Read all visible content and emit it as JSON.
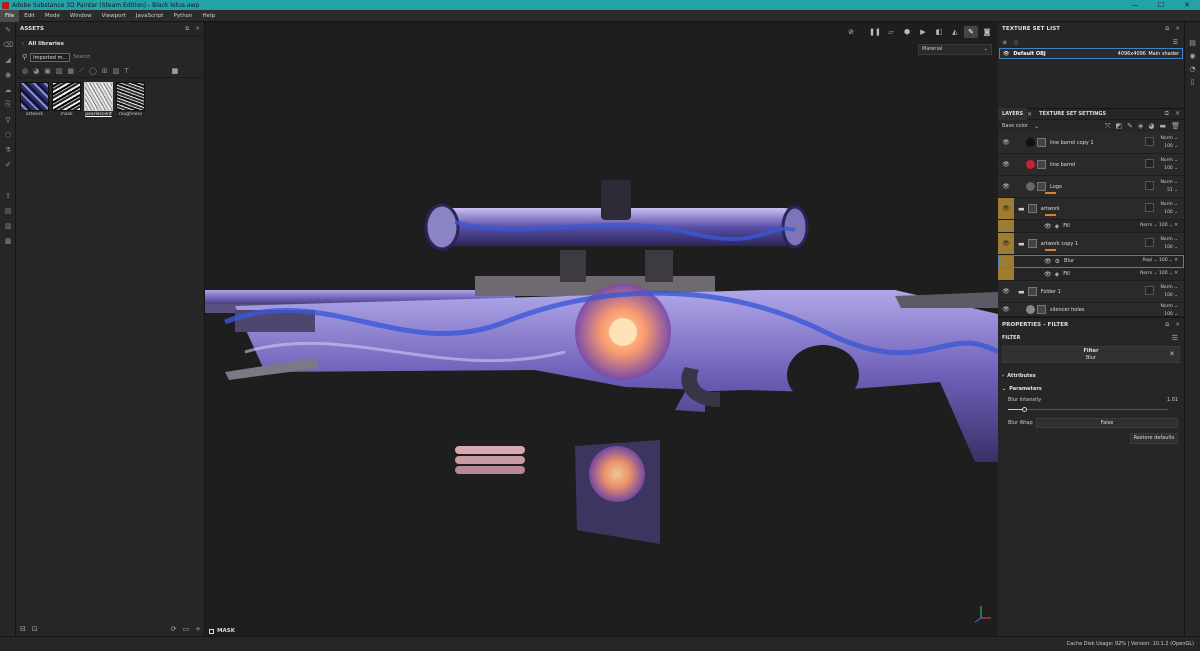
{
  "window": {
    "title": "Adobe Substance 3D Painter (Steam Edition) - Black lotus.awp"
  },
  "menu": [
    "File",
    "Edit",
    "Mode",
    "Window",
    "Viewport",
    "JavaScript",
    "Python",
    "Help"
  ],
  "assets": {
    "title": "ASSETS",
    "library": "All libraries",
    "filter_chip": "Imported m...",
    "search_placeholder": "Search",
    "thumbnails": [
      {
        "label": "artwork"
      },
      {
        "label": "mask"
      },
      {
        "label": "pearlescent"
      },
      {
        "label": "roughness"
      }
    ]
  },
  "viewport": {
    "material_mode": "Material",
    "mask_label": "MASK"
  },
  "texture_set_list": {
    "title": "TEXTURE SET LIST",
    "row": {
      "name": "Default OBJ",
      "resolution": "4096x4096",
      "shader": "Main shader"
    }
  },
  "layers": {
    "tab_layers": "LAYERS",
    "tab_settings": "TEXTURE SET SETTINGS",
    "channel": "Base color",
    "rows": [
      {
        "name": "line barrel copy 1",
        "blend": "Norm",
        "opacity": "100"
      },
      {
        "name": "line barrel",
        "blend": "Norm",
        "opacity": "100"
      },
      {
        "name": "Logo",
        "blend": "Norm",
        "opacity": "51"
      },
      {
        "name": "artwork",
        "blend": "Norm",
        "opacity": "100"
      },
      {
        "name": "Fill",
        "blend": "Norm",
        "opacity": "100"
      },
      {
        "name": "artwork copy 1",
        "blend": "Norm",
        "opacity": "100"
      },
      {
        "name": "Blur",
        "blend": "Repl",
        "opacity": "100"
      },
      {
        "name": "Fill",
        "blend": "Norm",
        "opacity": "100"
      },
      {
        "name": "Folder 1",
        "blend": "Norm",
        "opacity": "100"
      },
      {
        "name": "silencer holes",
        "blend": "Norm",
        "opacity": "100"
      }
    ]
  },
  "properties": {
    "title": "PROPERTIES - FILTER",
    "section": "FILTER",
    "filter_label": "Filter",
    "filter_name": "Blur",
    "attributes": "Attributes",
    "parameters": "Parameters",
    "blur_intensity_label": "Blur Intensity",
    "blur_intensity_value": "1.01",
    "blur_intensity_level": 0.1,
    "blur_wrap_label": "Blur Wrap",
    "blur_wrap_value": "False",
    "restore_label": "Restore defaults"
  },
  "status": {
    "text": "Cache Disk Usage:   92% | Version: 10.1.2 (OpenGL)"
  },
  "colors": {
    "titlebar": "#25a2a8",
    "selection": "#3f82c7",
    "group_gold": "#9e7c34",
    "opacity_bar": "#d9822b"
  }
}
